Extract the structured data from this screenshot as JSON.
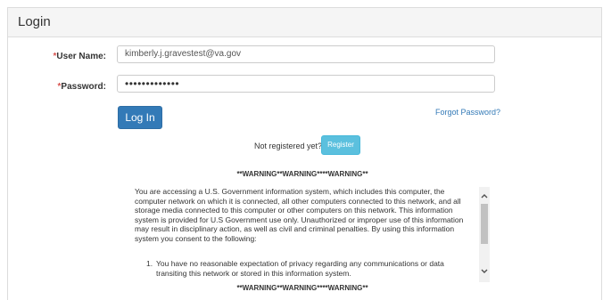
{
  "panel": {
    "title": "Login"
  },
  "form": {
    "username_label_req": "*",
    "username_label": "User Name:",
    "username_value": "kimberly.j.gravestest@va.gov",
    "password_label_req": "*",
    "password_label": "Password:",
    "password_mask": "•••••••••••••",
    "login_label": "Log In",
    "forgot_label": "Forgot Password?",
    "not_registered": "Not registered yet?",
    "register_label": "Register"
  },
  "warning": {
    "title": "**WARNING**WARNING****WARNING**",
    "body": "You are accessing a U.S. Government information system, which includes this computer, the computer network on which it is connected, all other computers connected to this network, and all storage media connected to this computer or other computers on this network. This information system is provided for U.S Government use only. Unauthorized or improper use of this information may result in disciplinary action, as well as civil and criminal penalties. By using this information system you consent to the following:",
    "item1_num": "1.",
    "item1": "You have no reasonable expectation of privacy regarding any communications or data transiting this network or stored in this information system.",
    "footer": "**WARNING**WARNING****WARNING**"
  },
  "colors": {
    "primary": "#337ab7",
    "info": "#5bc0de",
    "required": "#d9534f"
  },
  "icons": {
    "scroll_up": "chevron-up-icon",
    "scroll_down": "chevron-down-icon"
  }
}
